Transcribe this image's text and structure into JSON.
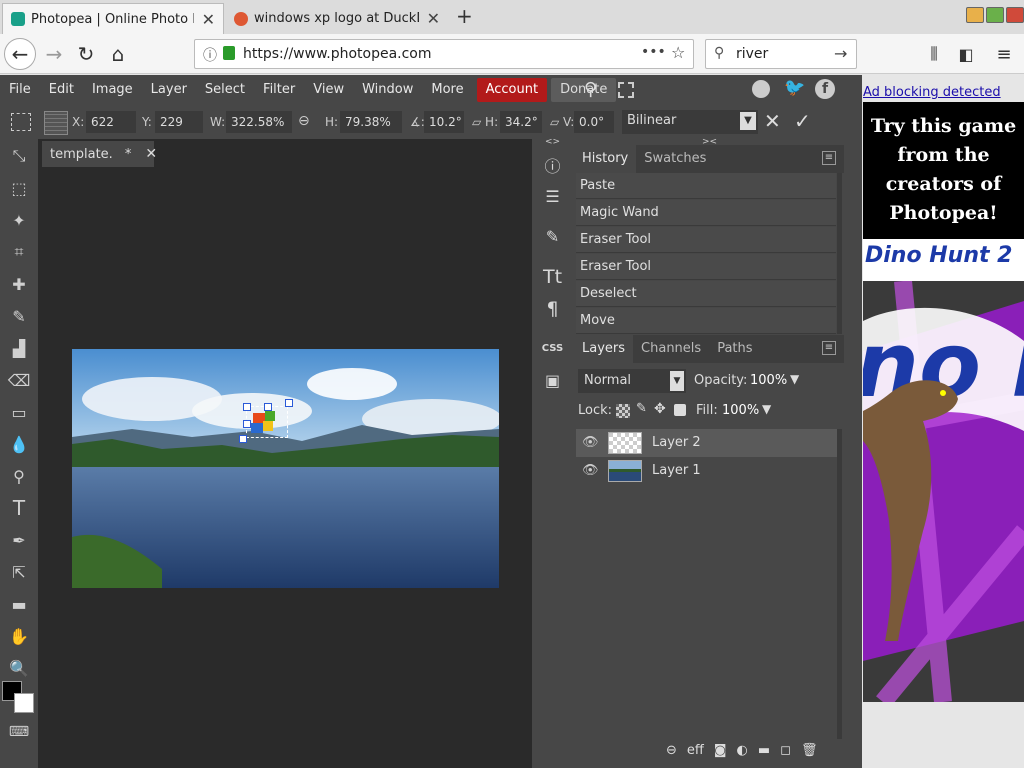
{
  "browser": {
    "tabs": [
      {
        "label": "Photopea | Online Photo Edit",
        "favicon_color": "#19a089",
        "active": true
      },
      {
        "label": "windows xp logo at DuckDuc",
        "favicon_color": "#de5833",
        "active": false
      }
    ],
    "new_tab_label": "+",
    "url": "https://www.photopea.com",
    "url_host": "www.photopea.com",
    "url_scheme": "https://",
    "search_value": "river",
    "page_actions": "•••"
  },
  "menu": {
    "items": [
      "File",
      "Edit",
      "Image",
      "Layer",
      "Select",
      "Filter",
      "View",
      "Window",
      "More"
    ],
    "account": "Account",
    "donate": "Donate"
  },
  "options": {
    "x_label": "X:",
    "x_value": "622 px",
    "y_label": "Y:",
    "y_value": "229 px",
    "w_label": "W:",
    "w_value": "322.58%",
    "h_label": "H:",
    "h_value": "79.38%",
    "angle_label": "∡:",
    "angle_value": "10.2°",
    "hskew_label": "▱ H:",
    "hskew_value": "34.2°",
    "vskew_label": "▱ V:",
    "vskew_value": "0.0°",
    "interpolation": "Bilinear"
  },
  "document": {
    "tab_label": "template.",
    "tab_modified": "*"
  },
  "history": {
    "tabs": [
      "History",
      "Swatches"
    ],
    "items": [
      "Paste",
      "Magic Wand",
      "Eraser Tool",
      "Eraser Tool",
      "Deselect",
      "Move"
    ]
  },
  "layers": {
    "tabs": [
      "Layers",
      "Channels",
      "Paths"
    ],
    "blend_mode": "Normal",
    "opacity_label": "Opacity:",
    "opacity_value": "100%",
    "lock_label": "Lock:",
    "fill_label": "Fill:",
    "fill_value": "100%",
    "list": [
      {
        "name": "Layer 2",
        "selected": true
      },
      {
        "name": "Layer 1",
        "selected": false
      }
    ]
  },
  "sidebar": {
    "css_label": "CSS"
  },
  "ad": {
    "blocking_text": "Ad blocking detected",
    "promo_text": "Try this game from the creators of Photopea!",
    "game_title": "Dino Hunt 2"
  },
  "colors": {
    "accent_red": "#b21a1a",
    "app_bg": "#474747",
    "canvas_bg": "#2a2a2a",
    "ad_purple": "#8a1fb8",
    "link_blue": "#1a0dab"
  }
}
